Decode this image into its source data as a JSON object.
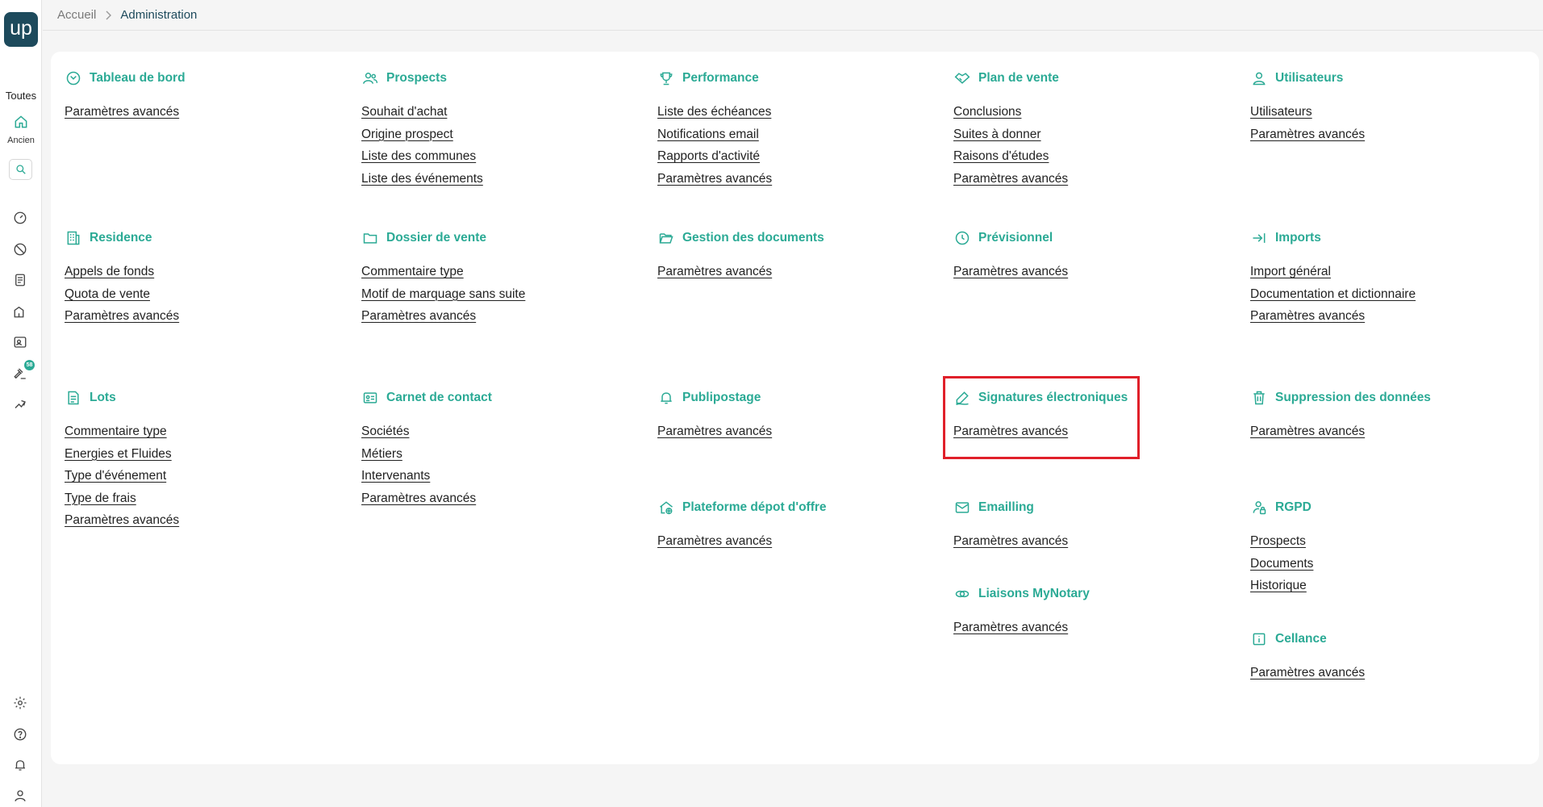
{
  "sidebar": {
    "logo": "up",
    "toutes": "Toutes",
    "ancien": "Ancien",
    "badge": "58"
  },
  "breadcrumb": {
    "home": "Accueil",
    "current": "Administration"
  },
  "sections": {
    "tableau_de_bord": {
      "title": "Tableau de bord",
      "links": [
        "Paramètres avancés"
      ]
    },
    "prospects": {
      "title": "Prospects",
      "links": [
        "Souhait d'achat",
        "Origine prospect",
        "Liste des communes",
        "Liste des événements"
      ]
    },
    "performance": {
      "title": "Performance",
      "links": [
        "Liste des échéances",
        "Notifications email",
        "Rapports d'activité",
        "Paramètres avancés"
      ]
    },
    "plan_de_vente": {
      "title": "Plan de vente",
      "links": [
        "Conclusions",
        "Suites à donner",
        "Raisons d'études",
        "Paramètres avancés"
      ]
    },
    "utilisateurs": {
      "title": "Utilisateurs",
      "links": [
        "Utilisateurs",
        "Paramètres avancés"
      ]
    },
    "residence": {
      "title": "Residence",
      "links": [
        "Appels de fonds",
        "Quota de vente",
        "Paramètres avancés"
      ]
    },
    "dossier_de_vente": {
      "title": "Dossier de vente",
      "links": [
        "Commentaire type",
        "Motif de marquage sans suite",
        "Paramètres avancés"
      ]
    },
    "gestion_documents": {
      "title": "Gestion des documents",
      "links": [
        "Paramètres avancés"
      ]
    },
    "previsionnel": {
      "title": "Prévisionnel",
      "links": [
        "Paramètres avancés"
      ]
    },
    "imports": {
      "title": "Imports",
      "links": [
        "Import général",
        "Documentation et dictionnaire",
        "Paramètres avancés"
      ]
    },
    "lots": {
      "title": "Lots",
      "links": [
        "Commentaire type",
        "Energies et Fluides",
        "Type d'événement",
        "Type de frais",
        "Paramètres avancés"
      ]
    },
    "carnet_contact": {
      "title": "Carnet de contact",
      "links": [
        "Sociétés",
        "Métiers",
        "Intervenants",
        "Paramètres avancés"
      ]
    },
    "publipostage": {
      "title": "Publipostage",
      "links": [
        "Paramètres avancés"
      ]
    },
    "signatures": {
      "title": "Signatures électroniques",
      "links": [
        "Paramètres avancés"
      ]
    },
    "suppression": {
      "title": "Suppression des données",
      "links": [
        "Paramètres avancés"
      ]
    },
    "plateforme": {
      "title": "Plateforme dépot d'offre",
      "links": [
        "Paramètres avancés"
      ]
    },
    "emailling": {
      "title": "Emailling",
      "links": [
        "Paramètres avancés"
      ]
    },
    "rgpd": {
      "title": "RGPD",
      "links": [
        "Prospects",
        "Documents",
        "Historique"
      ]
    },
    "liaisons": {
      "title": "Liaisons MyNotary",
      "links": [
        "Paramètres avancés"
      ]
    },
    "cellance": {
      "title": "Cellance",
      "links": [
        "Paramètres avancés"
      ]
    }
  },
  "colors": {
    "accent": "#2baa95",
    "brand": "#1d4a5c",
    "highlight": "#e0202a"
  }
}
